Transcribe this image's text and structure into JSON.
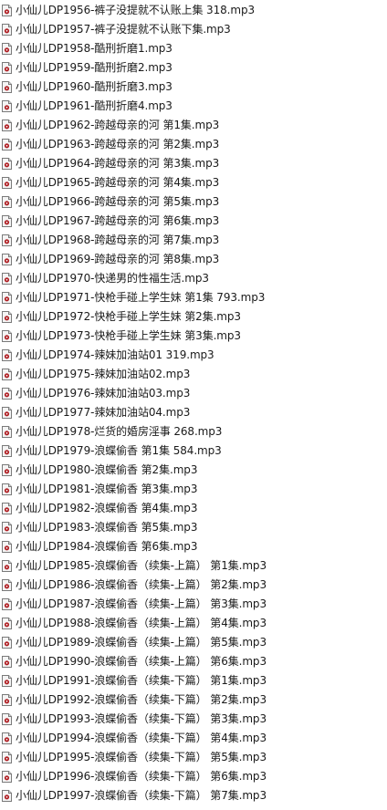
{
  "files": [
    {
      "name": "小仙儿DP1956-裤子没提就不认账上集 318.mp3",
      "icon": "audio-file-icon"
    },
    {
      "name": "小仙儿DP1957-裤子没提就不认账下集.mp3",
      "icon": "audio-file-icon"
    },
    {
      "name": "小仙儿DP1958-酷刑折磨1.mp3",
      "icon": "audio-file-icon"
    },
    {
      "name": "小仙儿DP1959-酷刑折磨2.mp3",
      "icon": "audio-file-icon"
    },
    {
      "name": "小仙儿DP1960-酷刑折磨3.mp3",
      "icon": "audio-file-icon"
    },
    {
      "name": "小仙儿DP1961-酷刑折磨4.mp3",
      "icon": "audio-file-icon"
    },
    {
      "name": "小仙儿DP1962-跨越母亲的河 第1集.mp3",
      "icon": "audio-file-icon"
    },
    {
      "name": "小仙儿DP1963-跨越母亲的河 第2集.mp3",
      "icon": "audio-file-icon"
    },
    {
      "name": "小仙儿DP1964-跨越母亲的河 第3集.mp3",
      "icon": "audio-file-icon"
    },
    {
      "name": "小仙儿DP1965-跨越母亲的河 第4集.mp3",
      "icon": "audio-file-icon"
    },
    {
      "name": "小仙儿DP1966-跨越母亲的河 第5集.mp3",
      "icon": "audio-file-icon"
    },
    {
      "name": "小仙儿DP1967-跨越母亲的河 第6集.mp3",
      "icon": "audio-file-icon"
    },
    {
      "name": "小仙儿DP1968-跨越母亲的河 第7集.mp3",
      "icon": "audio-file-icon"
    },
    {
      "name": "小仙儿DP1969-跨越母亲的河 第8集.mp3",
      "icon": "audio-file-icon"
    },
    {
      "name": "小仙儿DP1970-快递男的性福生活.mp3",
      "icon": "audio-file-icon"
    },
    {
      "name": "小仙儿DP1971-快枪手碰上学生妹 第1集 793.mp3",
      "icon": "audio-file-icon"
    },
    {
      "name": "小仙儿DP1972-快枪手碰上学生妹 第2集.mp3",
      "icon": "audio-file-icon"
    },
    {
      "name": "小仙儿DP1973-快枪手碰上学生妹 第3集.mp3",
      "icon": "audio-file-icon"
    },
    {
      "name": "小仙儿DP1974-辣妹加油站01 319.mp3",
      "icon": "audio-file-icon"
    },
    {
      "name": "小仙儿DP1975-辣妹加油站02.mp3",
      "icon": "audio-file-icon"
    },
    {
      "name": "小仙儿DP1976-辣妹加油站03.mp3",
      "icon": "audio-file-icon"
    },
    {
      "name": "小仙儿DP1977-辣妹加油站04.mp3",
      "icon": "audio-file-icon"
    },
    {
      "name": "小仙儿DP1978-烂货的婚房淫事 268.mp3",
      "icon": "audio-file-icon"
    },
    {
      "name": "小仙儿DP1979-浪蝶偷香 第1集 584.mp3",
      "icon": "audio-file-icon"
    },
    {
      "name": "小仙儿DP1980-浪蝶偷香 第2集.mp3",
      "icon": "audio-file-icon"
    },
    {
      "name": "小仙儿DP1981-浪蝶偷香 第3集.mp3",
      "icon": "audio-file-icon"
    },
    {
      "name": "小仙儿DP1982-浪蝶偷香 第4集.mp3",
      "icon": "audio-file-icon"
    },
    {
      "name": "小仙儿DP1983-浪蝶偷香 第5集.mp3",
      "icon": "audio-file-icon"
    },
    {
      "name": "小仙儿DP1984-浪蝶偷香 第6集.mp3",
      "icon": "audio-file-icon"
    },
    {
      "name": "小仙儿DP1985-浪蝶偷香（续集-上篇） 第1集.mp3",
      "icon": "audio-file-icon"
    },
    {
      "name": "小仙儿DP1986-浪蝶偷香（续集-上篇） 第2集.mp3",
      "icon": "audio-file-icon"
    },
    {
      "name": "小仙儿DP1987-浪蝶偷香（续集-上篇） 第3集.mp3",
      "icon": "audio-file-icon"
    },
    {
      "name": "小仙儿DP1988-浪蝶偷香（续集-上篇） 第4集.mp3",
      "icon": "audio-file-icon"
    },
    {
      "name": "小仙儿DP1989-浪蝶偷香（续集-上篇） 第5集.mp3",
      "icon": "audio-file-icon"
    },
    {
      "name": "小仙儿DP1990-浪蝶偷香（续集-上篇） 第6集.mp3",
      "icon": "audio-file-icon"
    },
    {
      "name": "小仙儿DP1991-浪蝶偷香（续集-下篇） 第1集.mp3",
      "icon": "audio-file-icon"
    },
    {
      "name": "小仙儿DP1992-浪蝶偷香（续集-下篇） 第2集.mp3",
      "icon": "audio-file-icon"
    },
    {
      "name": "小仙儿DP1993-浪蝶偷香（续集-下篇） 第3集.mp3",
      "icon": "audio-file-icon"
    },
    {
      "name": "小仙儿DP1994-浪蝶偷香（续集-下篇） 第4集.mp3",
      "icon": "audio-file-icon"
    },
    {
      "name": "小仙儿DP1995-浪蝶偷香（续集-下篇） 第5集.mp3",
      "icon": "audio-file-icon"
    },
    {
      "name": "小仙儿DP1996-浪蝶偷香（续集-下篇） 第6集.mp3",
      "icon": "audio-file-icon"
    },
    {
      "name": "小仙儿DP1997-浪蝶偷香（续集-下篇） 第7集.mp3",
      "icon": "audio-file-icon"
    }
  ],
  "colors": {
    "text": "#1a1a1a",
    "icon_page": "#f4f4f4",
    "icon_border": "#7a7a7a",
    "icon_accent": "#b01e23"
  }
}
